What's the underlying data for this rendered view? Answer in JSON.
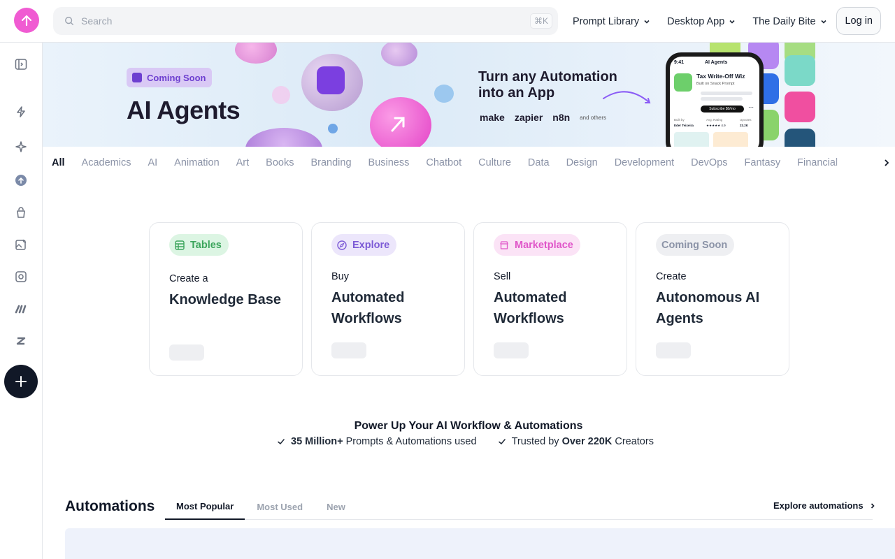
{
  "header": {
    "search_placeholder": "Search",
    "search_shortcut": "⌘K",
    "nav": [
      {
        "label": "Prompt Library"
      },
      {
        "label": "Desktop App"
      },
      {
        "label": "The Daily Bite"
      }
    ],
    "login_label": "Log in"
  },
  "banner": {
    "chip_label": "Coming Soon",
    "title": "AI Agents",
    "subtitle": "Turn any Automation into an App",
    "brands": [
      "make",
      "zapier",
      "n8n",
      "and others"
    ],
    "phone": {
      "time": "9:41",
      "header": "AI Agents",
      "app_name": "Tax Write-Off Wiz",
      "app_sub": "Built on Snack Prompt",
      "button": "Subscribe $0/mo",
      "built_by_label": "Built by",
      "built_by": "Eder Teixeira",
      "rating_label": "Avg. Rating",
      "rating": "★★★★★ 4.9",
      "upvotes_label": "Upvotes",
      "upvotes": "23.2K"
    }
  },
  "categories": [
    "All",
    "Academics",
    "AI",
    "Animation",
    "Art",
    "Books",
    "Branding",
    "Business",
    "Chatbot",
    "Culture",
    "Data",
    "Design",
    "Development",
    "DevOps",
    "Fantasy",
    "Financial"
  ],
  "cards": [
    {
      "badge": "Tables",
      "small": "Create a",
      "big": "Knowledge Base"
    },
    {
      "badge": "Explore",
      "small": "Buy",
      "big": "Automated Workflows"
    },
    {
      "badge": "Marketplace",
      "small": "Sell",
      "big": "Automated Workflows"
    },
    {
      "badge": "Coming Soon",
      "small": "Create",
      "big": "Autonomous AI Agents"
    }
  ],
  "power": {
    "title": "Power Up Your AI Workflow & Automations",
    "stat1_bold": "35 Million+",
    "stat1_rest": " Prompts & Automations used",
    "stat2_pre": "Trusted by ",
    "stat2_bold": "Over 220K",
    "stat2_rest": " Creators"
  },
  "automations": {
    "title": "Automations",
    "tabs": [
      "Most Popular",
      "Most Used",
      "New"
    ],
    "explore_label": "Explore automations"
  },
  "colors": {
    "brand_pink": "#f05bd2",
    "tables_bg": "#dcf5e3",
    "tables_fg": "#3ca55c",
    "explore_bg": "#ece6fb",
    "explore_fg": "#7c5ad6",
    "market_bg": "#fbe3f6",
    "market_fg": "#e056c9",
    "soon_bg": "#eeeff2",
    "soon_fg": "#8b93a7"
  }
}
